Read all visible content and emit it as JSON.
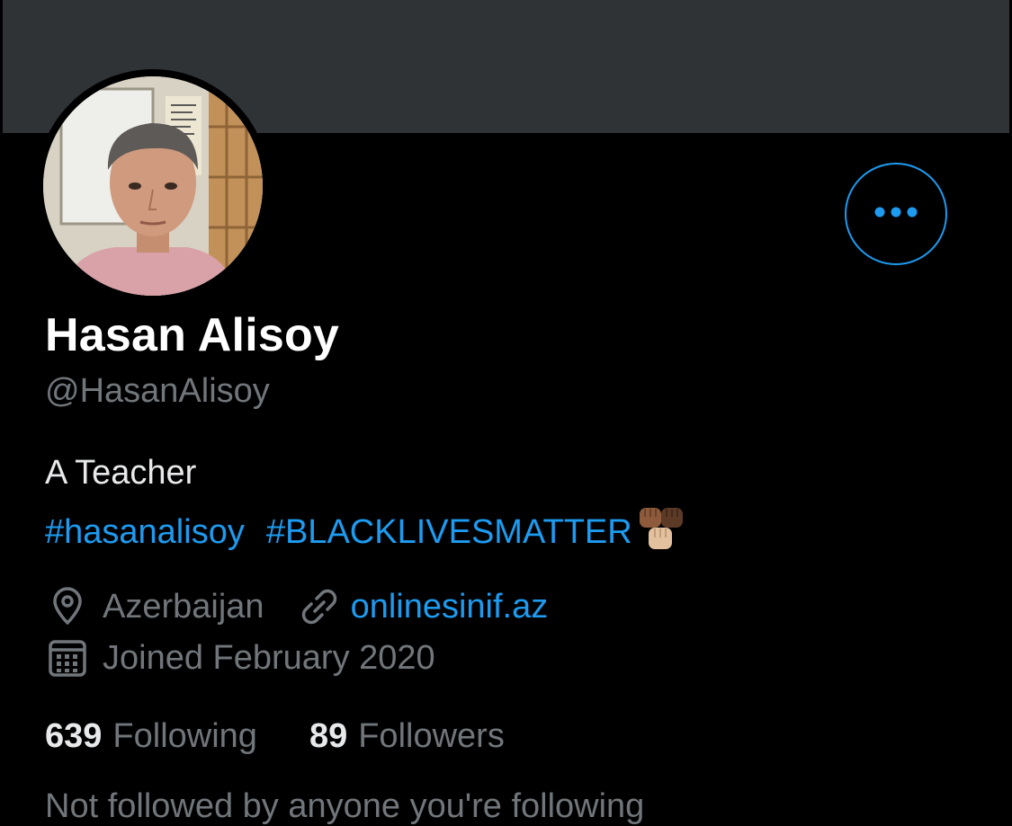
{
  "profile": {
    "display_name": "Hasan Alisoy",
    "handle": "@HasanAlisoy",
    "bio": "A Teacher",
    "hashtags": [
      "#hasanalisoy",
      "#BLACKLIVESMATTER"
    ],
    "location": "Azerbaijan",
    "website": "onlinesinif.az",
    "joined": "Joined February 2020",
    "following_count": "639",
    "following_label": "Following",
    "followers_count": "89",
    "followers_label": "Followers",
    "followed_by_partial": "Not followed by anyone you're following"
  },
  "icons": {
    "more": "more-horizontal-icon",
    "location": "location-pin-icon",
    "link": "link-icon",
    "calendar": "calendar-icon",
    "raised_fists": "raised-fists-emoji"
  },
  "colors": {
    "background": "#000000",
    "banner": "#2f3336",
    "accent": "#1d9bf0",
    "secondary_text": "#71767b",
    "primary_text": "#e7e9ea"
  }
}
